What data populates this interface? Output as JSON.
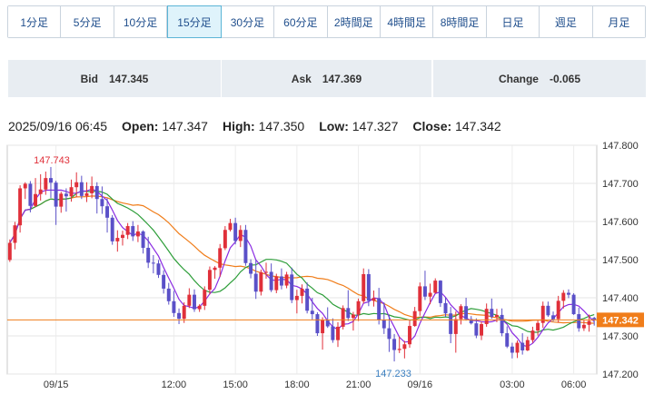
{
  "timeframes": [
    {
      "label": "1分足",
      "active": false
    },
    {
      "label": "5分足",
      "active": false
    },
    {
      "label": "10分足",
      "active": false
    },
    {
      "label": "15分足",
      "active": true
    },
    {
      "label": "30分足",
      "active": false
    },
    {
      "label": "60分足",
      "active": false
    },
    {
      "label": "2時間足",
      "active": false
    },
    {
      "label": "4時間足",
      "active": false
    },
    {
      "label": "8時間足",
      "active": false
    },
    {
      "label": "日足",
      "active": false
    },
    {
      "label": "週足",
      "active": false
    },
    {
      "label": "月足",
      "active": false
    }
  ],
  "quote": {
    "bid_label": "Bid",
    "bid": "147.345",
    "ask_label": "Ask",
    "ask": "147.369",
    "change_label": "Change",
    "change": "-0.065"
  },
  "ohlc": {
    "datetime": "2025/09/16 06:45",
    "open_label": "Open:",
    "open": "147.347",
    "high_label": "High:",
    "high": "147.350",
    "low_label": "Low:",
    "low": "147.327",
    "close_label": "Close:",
    "close": "147.342"
  },
  "chart_data": {
    "type": "candlestick",
    "ylim": [
      147.2,
      147.8
    ],
    "y_ticks": [
      "147.800",
      "147.700",
      "147.600",
      "147.500",
      "147.400",
      "147.300",
      "147.200"
    ],
    "x_ticks": [
      "09/15",
      "12:00",
      "15:00",
      "18:00",
      "21:00",
      "09/16",
      "03:00",
      "06:00"
    ],
    "high_annotation": "147.743",
    "low_annotation": "147.233",
    "last_price": "147.342",
    "colors": {
      "up": "#e0303a",
      "down": "#5a50c8",
      "ma_short": "#8a2be2",
      "ma_mid": "#2e9e3a",
      "ma_long": "#f07d1a",
      "last_line": "#f07d1a",
      "high_label": "#e0303a",
      "low_label": "#3a7fc0"
    },
    "candles": [
      [
        147.499,
        147.553,
        147.494,
        147.544
      ],
      [
        147.544,
        147.599,
        147.527,
        147.59
      ],
      [
        147.59,
        147.695,
        147.571,
        147.687
      ],
      [
        147.687,
        147.703,
        147.659,
        147.699
      ],
      [
        147.699,
        147.706,
        147.624,
        147.641
      ],
      [
        147.641,
        147.714,
        147.638,
        147.672
      ],
      [
        147.672,
        147.724,
        147.655,
        147.684
      ],
      [
        147.684,
        147.731,
        147.67,
        147.714
      ],
      [
        147.714,
        147.743,
        147.662,
        147.702
      ],
      [
        147.702,
        147.707,
        147.591,
        147.639
      ],
      [
        147.639,
        147.678,
        147.623,
        147.673
      ],
      [
        147.673,
        147.687,
        147.626,
        147.666
      ],
      [
        147.666,
        147.71,
        147.652,
        147.69
      ],
      [
        147.69,
        147.729,
        147.664,
        147.703
      ],
      [
        147.703,
        147.72,
        147.659,
        147.667
      ],
      [
        147.667,
        147.703,
        147.651,
        147.674
      ],
      [
        147.674,
        147.718,
        147.661,
        147.693
      ],
      [
        147.693,
        147.703,
        147.621,
        147.659
      ],
      [
        147.659,
        147.692,
        147.62,
        147.64
      ],
      [
        147.64,
        147.661,
        147.571,
        147.61
      ],
      [
        147.61,
        147.617,
        147.539,
        147.548
      ],
      [
        147.548,
        147.577,
        147.521,
        147.557
      ],
      [
        147.557,
        147.576,
        147.537,
        147.565
      ],
      [
        147.565,
        147.596,
        147.554,
        147.588
      ],
      [
        147.588,
        147.601,
        147.549,
        147.561
      ],
      [
        147.561,
        147.591,
        147.546,
        147.574
      ],
      [
        147.574,
        147.577,
        147.516,
        147.531
      ],
      [
        147.531,
        147.56,
        147.478,
        147.492
      ],
      [
        147.492,
        147.512,
        147.464,
        147.49
      ],
      [
        147.49,
        147.499,
        147.452,
        147.46
      ],
      [
        147.46,
        147.472,
        147.411,
        147.424
      ],
      [
        147.424,
        147.439,
        147.382,
        147.391
      ],
      [
        147.391,
        147.418,
        147.35,
        147.36
      ],
      [
        147.36,
        147.372,
        147.331,
        147.345
      ],
      [
        147.345,
        147.388,
        147.334,
        147.379
      ],
      [
        147.379,
        147.425,
        147.373,
        147.408
      ],
      [
        147.408,
        147.422,
        147.363,
        147.37
      ],
      [
        147.37,
        147.383,
        147.363,
        147.379
      ],
      [
        147.379,
        147.43,
        147.368,
        147.421
      ],
      [
        147.421,
        147.482,
        147.409,
        147.473
      ],
      [
        147.473,
        147.483,
        147.45,
        147.479
      ],
      [
        147.479,
        147.541,
        147.455,
        147.53
      ],
      [
        147.53,
        147.588,
        147.525,
        147.578
      ],
      [
        147.578,
        147.607,
        147.574,
        147.596
      ],
      [
        147.596,
        147.61,
        147.54,
        147.549
      ],
      [
        147.549,
        147.59,
        147.533,
        147.578
      ],
      [
        147.578,
        147.591,
        147.484,
        147.491
      ],
      [
        147.491,
        147.501,
        147.451,
        147.463
      ],
      [
        147.463,
        147.498,
        147.397,
        147.416
      ],
      [
        147.416,
        147.474,
        147.406,
        147.467
      ],
      [
        147.467,
        147.492,
        147.45,
        147.468
      ],
      [
        147.468,
        147.49,
        147.415,
        147.42
      ],
      [
        147.42,
        147.463,
        147.412,
        147.456
      ],
      [
        147.456,
        147.477,
        147.422,
        147.432
      ],
      [
        147.432,
        147.468,
        147.425,
        147.461
      ],
      [
        147.461,
        147.479,
        147.386,
        147.394
      ],
      [
        147.394,
        147.421,
        147.359,
        147.405
      ],
      [
        147.405,
        147.435,
        147.385,
        147.424
      ],
      [
        147.424,
        147.44,
        147.359,
        147.366
      ],
      [
        147.366,
        147.4,
        147.343,
        147.357
      ],
      [
        147.357,
        147.362,
        147.3,
        147.307
      ],
      [
        147.307,
        147.349,
        147.264,
        147.341
      ],
      [
        147.341,
        147.375,
        147.321,
        147.325
      ],
      [
        147.325,
        147.346,
        147.282,
        147.289
      ],
      [
        147.289,
        147.336,
        147.271,
        147.324
      ],
      [
        147.324,
        147.38,
        147.317,
        147.373
      ],
      [
        147.373,
        147.42,
        147.339,
        147.347
      ],
      [
        147.347,
        147.363,
        147.314,
        147.356
      ],
      [
        147.356,
        147.398,
        147.339,
        147.391
      ],
      [
        147.391,
        147.477,
        147.385,
        147.462
      ],
      [
        147.462,
        147.475,
        147.378,
        147.392
      ],
      [
        147.392,
        147.419,
        147.377,
        147.399
      ],
      [
        147.399,
        147.426,
        147.33,
        147.342
      ],
      [
        147.342,
        147.388,
        147.305,
        147.32
      ],
      [
        147.32,
        147.354,
        147.258,
        147.292
      ],
      [
        147.292,
        147.305,
        147.233,
        147.263
      ],
      [
        147.263,
        147.298,
        147.255,
        147.266
      ],
      [
        147.266,
        147.287,
        147.241,
        147.278
      ],
      [
        147.278,
        147.34,
        147.269,
        147.326
      ],
      [
        147.326,
        147.376,
        147.324,
        147.365
      ],
      [
        147.365,
        147.44,
        147.353,
        147.43
      ],
      [
        147.43,
        147.471,
        147.394,
        147.403
      ],
      [
        147.403,
        147.437,
        147.383,
        147.413
      ],
      [
        147.413,
        147.451,
        147.411,
        147.445
      ],
      [
        147.445,
        147.446,
        147.376,
        147.386
      ],
      [
        147.386,
        147.401,
        147.35,
        147.359
      ],
      [
        147.359,
        147.376,
        147.281,
        147.305
      ],
      [
        147.305,
        147.364,
        147.256,
        147.344
      ],
      [
        147.344,
        147.383,
        147.33,
        147.378
      ],
      [
        147.378,
        147.4,
        147.34,
        147.344
      ],
      [
        147.344,
        147.352,
        147.33,
        147.333
      ],
      [
        147.333,
        147.346,
        147.294,
        147.301
      ],
      [
        147.301,
        147.338,
        147.289,
        147.331
      ],
      [
        147.331,
        147.385,
        147.324,
        147.371
      ],
      [
        147.371,
        147.398,
        147.345,
        147.35
      ],
      [
        147.35,
        147.371,
        147.336,
        147.355
      ],
      [
        147.355,
        147.372,
        147.299,
        147.307
      ],
      [
        147.307,
        147.325,
        147.268,
        147.272
      ],
      [
        147.272,
        147.282,
        147.241,
        147.256
      ],
      [
        147.256,
        147.288,
        147.242,
        147.282
      ],
      [
        147.282,
        147.307,
        147.251,
        147.262
      ],
      [
        147.262,
        147.298,
        147.26,
        147.289
      ],
      [
        147.289,
        147.324,
        147.282,
        147.314
      ],
      [
        147.314,
        147.34,
        147.301,
        147.334
      ],
      [
        147.334,
        147.39,
        147.321,
        147.379
      ],
      [
        147.379,
        147.39,
        147.35,
        147.354
      ],
      [
        147.354,
        147.364,
        147.338,
        147.344
      ],
      [
        147.344,
        147.405,
        147.335,
        147.392
      ],
      [
        147.392,
        147.42,
        147.372,
        147.413
      ],
      [
        147.413,
        147.422,
        147.399,
        147.408
      ],
      [
        147.408,
        147.412,
        147.355,
        147.357
      ],
      [
        147.357,
        147.374,
        147.311,
        147.32
      ],
      [
        147.32,
        147.341,
        147.313,
        147.329
      ],
      [
        147.329,
        147.356,
        147.311,
        147.339
      ],
      [
        147.347,
        147.35,
        147.327,
        147.342
      ]
    ]
  }
}
